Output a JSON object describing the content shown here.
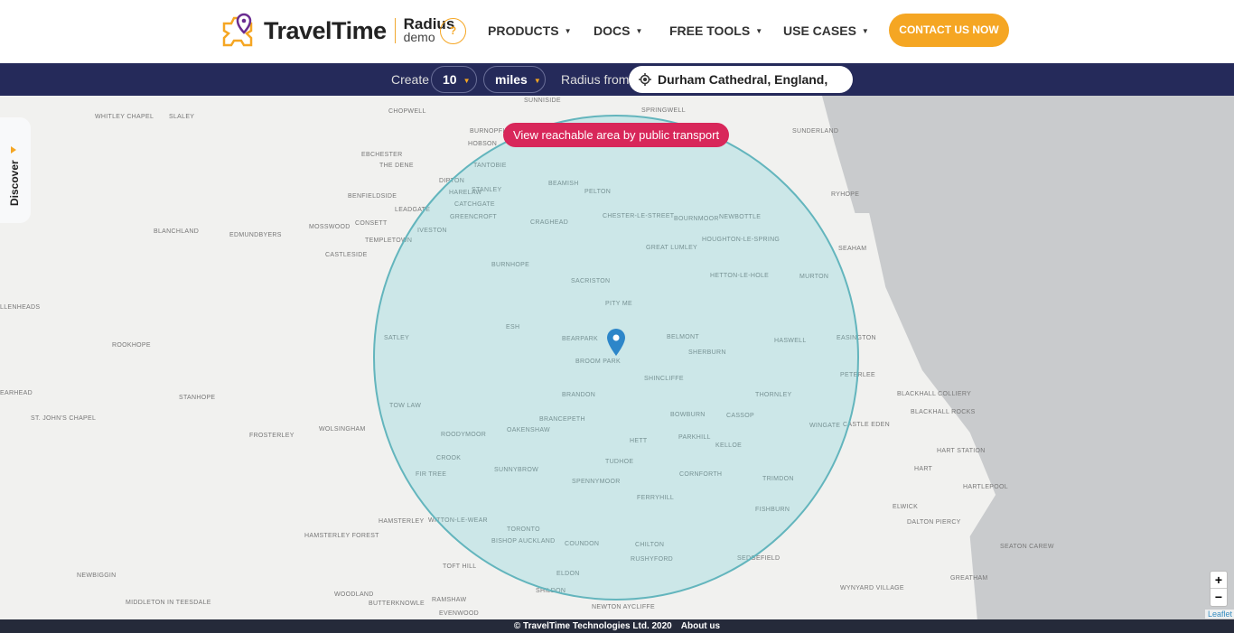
{
  "header": {
    "brand": "TravelTime",
    "product": "Radius",
    "product_sub": "demo",
    "help_label": "?",
    "nav": [
      {
        "label": "PRODUCTS"
      },
      {
        "label": "DOCS"
      },
      {
        "label": "FREE TOOLS"
      },
      {
        "label": "USE CASES"
      }
    ],
    "caret": "▼",
    "cta_label": "CONTACT US NOW"
  },
  "toolbar": {
    "create_label": "Create",
    "distance_value": "10",
    "unit_value": "miles",
    "radius_from_label": "Radius from",
    "location_value": "Durham Cathedral, England, Uni..."
  },
  "map": {
    "public_transport_button": "View reachable area by public transport",
    "discover_label": "Discover",
    "zoom_in": "+",
    "zoom_out": "−",
    "attribution": "Leaflet",
    "radius_circle_color": "#63b5bd",
    "places": [
      "WHITLEY CHAPEL",
      "SLALEY",
      "CHOPWELL",
      "SUNNISIDE",
      "SPRINGWELL",
      "SUNDERLAND",
      "BURNOPFIELD",
      "HOBSON",
      "EBCHESTER",
      "THE DENE",
      "TANTOBIE",
      "DIPTON",
      "STANLEY",
      "BEAMISH",
      "PELTON",
      "RYHOPE",
      "BENFIELDSIDE",
      "LEADGATE",
      "HARELAW",
      "CATCHGATE",
      "GREENCROFT",
      "CRAGHEAD",
      "CHESTER-LE-STREET",
      "BOURNMOOR",
      "NEWBOTTLE",
      "BLANCHLAND",
      "EDMUNDBYERS",
      "MOSSWOOD",
      "CONSETT",
      "TEMPLETOWN",
      "IVESTON",
      "GREAT LUMLEY",
      "HOUGHTON-LE-SPRING",
      "SEAHAM",
      "CASTLESIDE",
      "BURNHOPE",
      "HETTON-LE-HOLE",
      "MURTON",
      "SACRISTON",
      "PITY ME",
      "LLENHEADS",
      "ESH",
      "SATLEY",
      "BEARPARK",
      "BROOM PARK",
      "BELMONT",
      "SHERBURN",
      "HASWELL",
      "EASINGTON",
      "ROOKHOPE",
      "SHINCLIFFE",
      "PETERLEE",
      "EARHEAD",
      "STANHOPE",
      "TOW LAW",
      "BRANDON",
      "THORNLEY",
      "BLACKHALL COLLIERY",
      "BLACKHALL ROCKS",
      "ST. JOHN'S CHAPEL",
      "FROSTERLEY",
      "WOLSINGHAM",
      "BRANCEPETH",
      "OAKENSHAW",
      "BOWBURN",
      "CASSOP",
      "WINGATE",
      "CASTLE EDEN",
      "ROODYMOOR",
      "HETT",
      "PARKHILL",
      "KELLOE",
      "HART STATION",
      "CROOK",
      "SUNNYBROW",
      "TUDHOE",
      "CORNFORTH",
      "TRIMDON",
      "HART",
      "FIR TREE",
      "SPENNYMOOR",
      "HARTLEPOOL",
      "FERRYHILL",
      "ELWICK",
      "FISHBURN",
      "HAMSTERLEY",
      "WITTON-LE-WEAR",
      "TORONTO",
      "DALTON PIERCY",
      "HAMSTERLEY FOREST",
      "BISHOP AUCKLAND",
      "COUNDON",
      "CHILTON",
      "SEATON CAREW",
      "TOFT HILL",
      "RUSHYFORD",
      "SEDGEFIELD",
      "NEWBIGGIN",
      "ELDON",
      "GREATHAM",
      "WOODLAND",
      "SHILDON",
      "WYNYARD VILLAGE",
      "MIDDLETON IN TEESDALE",
      "BUTTERKNOWLE",
      "RAMSHAW",
      "NEWTON AYCLIFFE",
      "EVENWOOD"
    ]
  },
  "footer": {
    "copyright": "© TravelTime Technologies Ltd. 2020",
    "about_link": "About us"
  },
  "colors": {
    "accent": "#f5a623",
    "toolbar_bg": "#252a5a",
    "transport_button": "#d8275a",
    "pin": "#2d86c9"
  }
}
